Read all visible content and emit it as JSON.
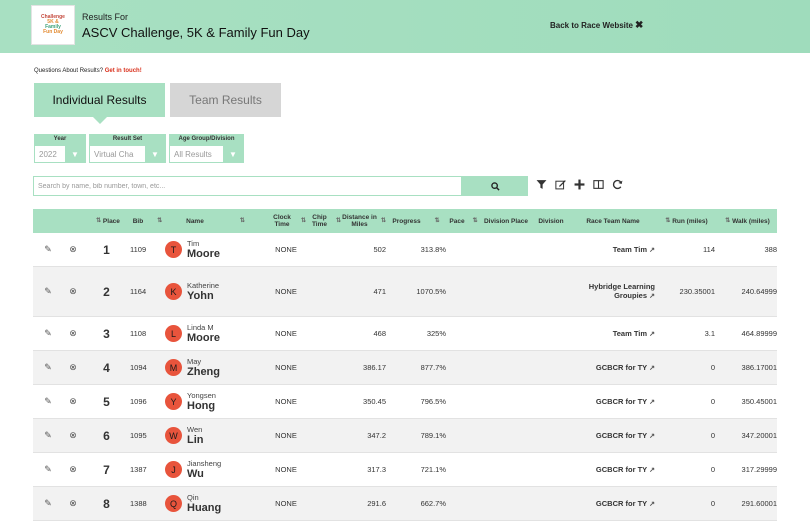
{
  "header": {
    "logo": {
      "line1": "Challenge",
      "line2": "5K &",
      "line3": "Family",
      "line4": "Fun Day"
    },
    "subtitle": "Results For",
    "title": "ASCV Challenge, 5K & Family Fun Day",
    "back_label": "Back to Race Website",
    "back_icon": "✖"
  },
  "questions": {
    "text": "Questions About Results?",
    "link": "Get in touch!"
  },
  "tabs": {
    "individual": "Individual Results",
    "team": "Team Results"
  },
  "filters": {
    "year": {
      "label": "Year",
      "value": "2022"
    },
    "result_set": {
      "label": "Result Set",
      "value": "Virtual Cha"
    },
    "age_group": {
      "label": "Age Group/Division",
      "value": "All Results"
    }
  },
  "search": {
    "placeholder": "Search by name, bib number, town, etc..."
  },
  "columns": {
    "place": "Place",
    "bib": "Bib",
    "name": "Name",
    "clock_time": "Clock Time",
    "chip_time": "Chip Time",
    "distance": "Distance in Miles",
    "progress": "Progress",
    "pace": "Pace",
    "division_place": "Division Place",
    "division": "Division",
    "race_team": "Race Team Name",
    "run": "Run (miles)",
    "walk": "Walk (miles)"
  },
  "rows": [
    {
      "place": "1",
      "bib": "1109",
      "initial": "T",
      "first": "Tim",
      "last": "Moore",
      "clock": "NONE",
      "distance": "502",
      "progress": "313.8%",
      "team": "Team Tim",
      "run": "114",
      "walk": "388"
    },
    {
      "place": "2",
      "bib": "1164",
      "initial": "K",
      "first": "Katherine",
      "last": "Yohn",
      "clock": "NONE",
      "distance": "471",
      "progress": "1070.5%",
      "team": "Hybridge Learning Groupies",
      "run": "230.35001",
      "walk": "240.64999"
    },
    {
      "place": "3",
      "bib": "1108",
      "initial": "L",
      "first": "Linda M",
      "last": "Moore",
      "clock": "NONE",
      "distance": "468",
      "progress": "325%",
      "team": "Team Tim",
      "run": "3.1",
      "walk": "464.89999"
    },
    {
      "place": "4",
      "bib": "1094",
      "initial": "M",
      "first": "May",
      "last": "Zheng",
      "clock": "NONE",
      "distance": "386.17",
      "progress": "877.7%",
      "team": "GCBCR for TY",
      "run": "0",
      "walk": "386.17001"
    },
    {
      "place": "5",
      "bib": "1096",
      "initial": "Y",
      "first": "Yongsen",
      "last": "Hong",
      "clock": "NONE",
      "distance": "350.45",
      "progress": "796.5%",
      "team": "GCBCR for TY",
      "run": "0",
      "walk": "350.45001"
    },
    {
      "place": "6",
      "bib": "1095",
      "initial": "W",
      "first": "Wen",
      "last": "Lin",
      "clock": "NONE",
      "distance": "347.2",
      "progress": "789.1%",
      "team": "GCBCR for TY",
      "run": "0",
      "walk": "347.20001"
    },
    {
      "place": "7",
      "bib": "1387",
      "initial": "J",
      "first": "Jiansheng",
      "last": "Wu",
      "clock": "NONE",
      "distance": "317.3",
      "progress": "721.1%",
      "team": "GCBCR for TY",
      "run": "0",
      "walk": "317.29999"
    },
    {
      "place": "8",
      "bib": "1388",
      "initial": "Q",
      "first": "Qin",
      "last": "Huang",
      "clock": "NONE",
      "distance": "291.6",
      "progress": "662.7%",
      "team": "GCBCR for TY",
      "run": "0",
      "walk": "291.60001"
    }
  ],
  "icons": {
    "edit": "edit-icon",
    "remove": "remove-icon",
    "external": "external-link-icon"
  },
  "colors": {
    "accent": "#a8e0c2",
    "avatar": "#e8543c",
    "link": "#d9301c"
  }
}
